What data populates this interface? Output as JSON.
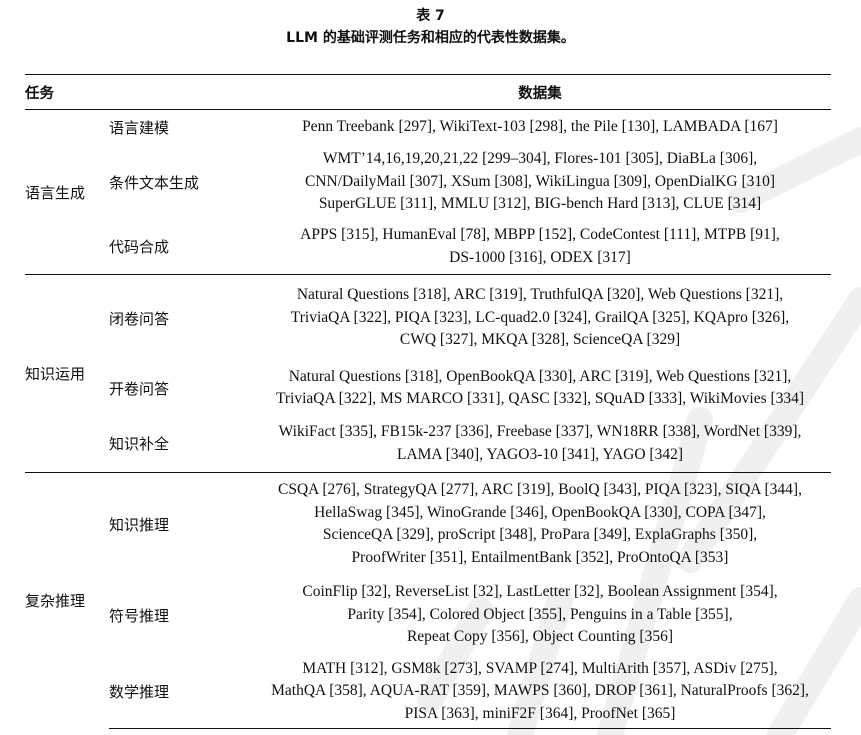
{
  "caption": {
    "label": "表 7",
    "title": "LLM 的基础评测任务和相应的代表性数据集。"
  },
  "header": {
    "task": "任务",
    "dataset": "数据集"
  },
  "groups": [
    {
      "name": "语言生成",
      "rows": [
        {
          "task": "语言建模",
          "lines": [
            "Penn Treebank [297], WikiText-103 [298], the Pile [130], LAMBADA [167]"
          ]
        },
        {
          "task": "条件文本生成",
          "lines": [
            "WMT’14,16,19,20,21,22 [299–304], Flores-101 [305], DiaBLa [306],",
            "CNN/DailyMail [307], XSum [308], WikiLingua [309], OpenDialKG [310]",
            "SuperGLUE [311], MMLU [312], BIG-bench Hard [313], CLUE [314]"
          ]
        },
        {
          "task": "代码合成",
          "lines": [
            "APPS [315], HumanEval [78], MBPP [152], CodeContest [111], MTPB [91],",
            "DS-1000 [316], ODEX [317]"
          ]
        }
      ]
    },
    {
      "name": "知识运用",
      "rows": [
        {
          "task": "闭卷问答",
          "lines": [
            "Natural Questions [318], ARC [319], TruthfulQA [320], Web Questions [321],",
            "TriviaQA [322], PIQA [323], LC-quad2.0 [324], GrailQA [325], KQApro [326],",
            "CWQ [327], MKQA [328], ScienceQA [329]"
          ]
        },
        {
          "task": "开卷问答",
          "lines": [
            "Natural Questions [318], OpenBookQA [330], ARC [319], Web Questions [321],",
            "TriviaQA [322], MS MARCO [331], QASC [332], SQuAD [333], WikiMovies [334]"
          ]
        },
        {
          "task": "知识补全",
          "lines": [
            "WikiFact [335], FB15k-237 [336], Freebase [337], WN18RR [338], WordNet [339],",
            "LAMA [340], YAGO3-10 [341], YAGO [342]"
          ]
        }
      ]
    },
    {
      "name": "复杂推理",
      "rows": [
        {
          "task": "知识推理",
          "lines": [
            "CSQA [276], StrategyQA [277], ARC [319], BoolQ [343], PIQA [323], SIQA [344],",
            "HellaSwag [345], WinoGrande [346], OpenBookQA [330], COPA [347],",
            "ScienceQA [329], proScript [348], ProPara [349], ExplaGraphs [350],",
            "ProofWriter [351], EntailmentBank [352], ProOntoQA [353]"
          ]
        },
        {
          "task": "符号推理",
          "lines": [
            "CoinFlip [32], ReverseList [32], LastLetter [32], Boolean Assignment [354],",
            "Parity [354], Colored Object [355], Penguins in a Table [355],",
            "Repeat Copy [356], Object Counting [356]"
          ]
        },
        {
          "task": "数学推理",
          "lines": [
            "MATH [312], GSM8k [273], SVAMP [274], MultiArith [357], ASDiv [275],",
            "MathQA [358], AQUA-RAT [359], MAWPS [360], DROP [361], NaturalProofs [362],",
            "PISA [363], miniF2F [364], ProofNet [365]"
          ]
        }
      ]
    }
  ]
}
